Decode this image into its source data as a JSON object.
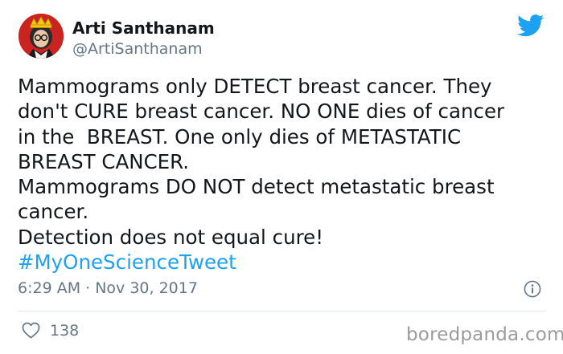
{
  "header": {
    "display_name": "Arti Santhanam",
    "handle": "@ArtiSanthanam",
    "avatar_icon": "avatar-portrait-crown",
    "logo_icon": "twitter-bird-icon",
    "logo_color": "#1da1f2"
  },
  "tweet": {
    "lines": [
      "Mammograms only DETECT breast cancer. They",
      "don't CURE breast cancer. NO ONE dies of cancer",
      "in the  BREAST. One only dies of METASTATIC",
      "BREAST CANCER.",
      "Mammograms DO NOT detect metastatic breast",
      "cancer.",
      "Detection does not equal cure!"
    ],
    "hashtag": "#MyOneScienceTweet",
    "hashtag_color": "#1da1f2"
  },
  "meta": {
    "timestamp": "6:29 AM · Nov 30, 2017",
    "info_icon": "info-icon"
  },
  "actions": {
    "like_icon": "heart-icon",
    "like_count": "138"
  },
  "watermark": "boredpanda.com"
}
